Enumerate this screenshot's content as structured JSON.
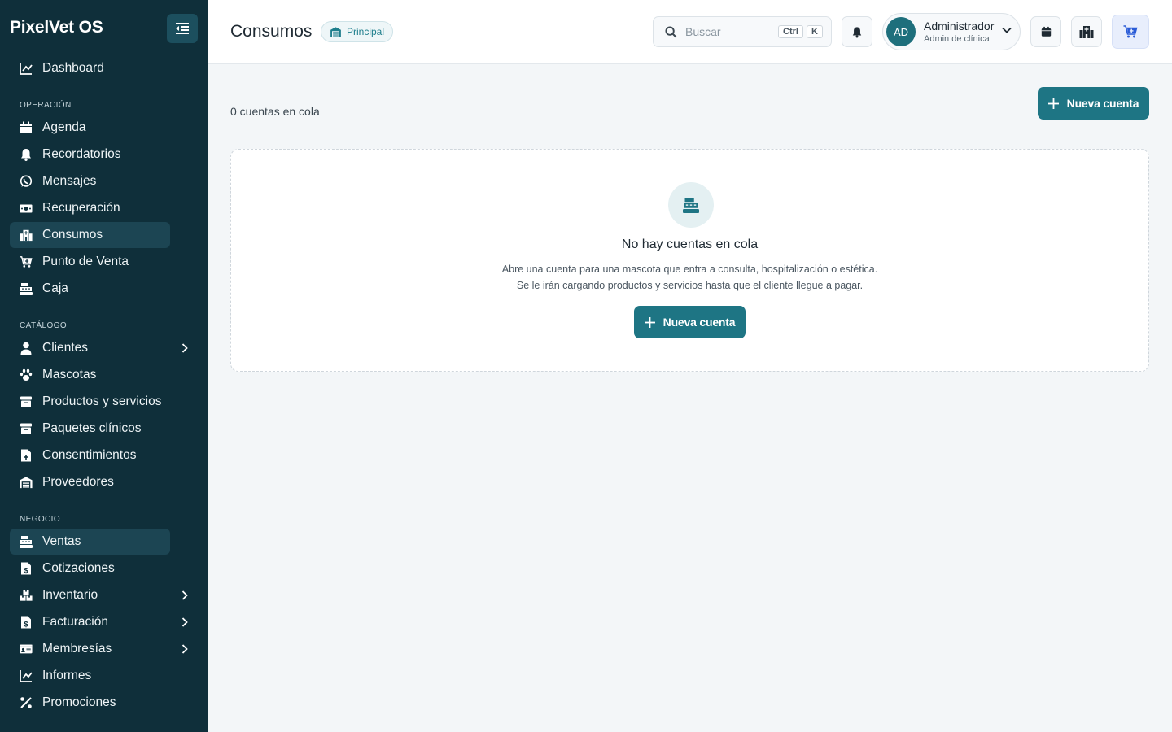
{
  "app": {
    "name": "PixelVet OS"
  },
  "sidebar": {
    "sections": {
      "operacion": "OPERACIÓN",
      "catalogo": "CATÁLOGO",
      "negocio": "NEGOCIO"
    },
    "items": {
      "dashboard": "Dashboard",
      "agenda": "Agenda",
      "recordatorios": "Recordatorios",
      "mensajes": "Mensajes",
      "recuperacion": "Recuperación",
      "consumos": "Consumos",
      "punto_venta": "Punto de Venta",
      "caja": "Caja",
      "clientes": "Clientes",
      "mascotas": "Mascotas",
      "productos": "Productos y servicios",
      "paquetes": "Paquetes clínicos",
      "consentimientos": "Consentimientos",
      "proveedores": "Proveedores",
      "ventas": "Ventas",
      "cotizaciones": "Cotizaciones",
      "inventario": "Inventario",
      "facturacion": "Facturación",
      "membresias": "Membresías",
      "informes": "Informes",
      "promociones": "Promociones"
    },
    "active": [
      "Consumos",
      "Ventas"
    ]
  },
  "header": {
    "title": "Consumos",
    "branch": "Principal",
    "search_placeholder": "Buscar",
    "kbd_ctrl": "Ctrl",
    "kbd_k": "K",
    "user": {
      "initials": "AD",
      "name": "Administrador",
      "role": "Admin de clínica"
    }
  },
  "main": {
    "queue_count": "0 cuentas en cola",
    "new_account_label": "Nueva cuenta",
    "empty": {
      "title": "No hay cuentas en cola",
      "line1": "Abre una cuenta para una mascota que entra a consulta, hospitalización o estética.",
      "line2": "Se le irán cargando productos y servicios hasta que el cliente llegue a pagar.",
      "button": "Nueva cuenta"
    }
  },
  "colors": {
    "sidebar_bg": "#0f2f3a",
    "accent": "#1e7584",
    "active_item": "#1c4553"
  }
}
